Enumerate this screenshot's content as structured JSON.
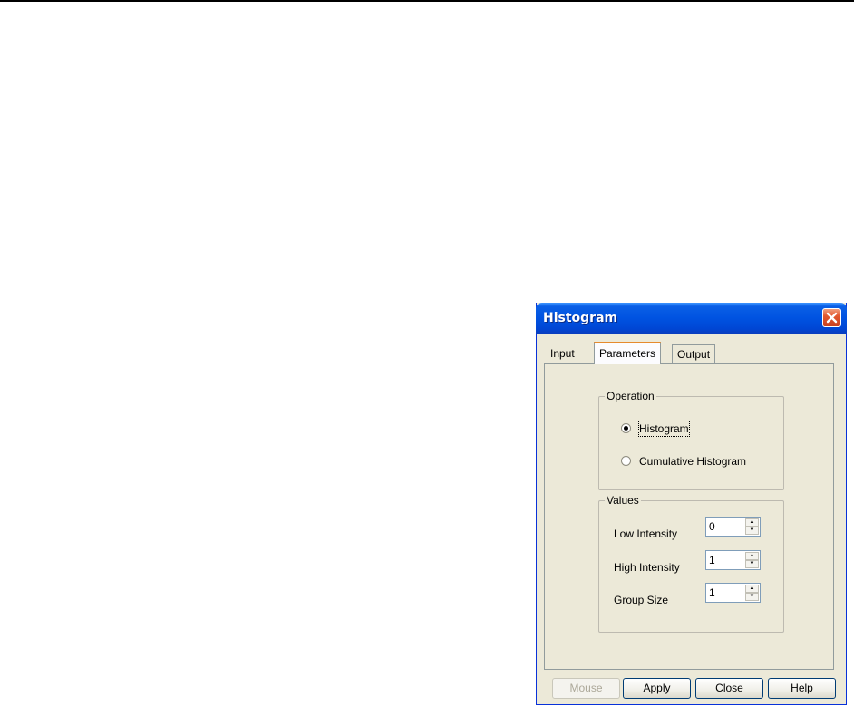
{
  "window": {
    "title": "Histogram"
  },
  "tabs": [
    {
      "label": "Input"
    },
    {
      "label": "Parameters"
    },
    {
      "label": "Output"
    }
  ],
  "operation": {
    "group_label": "Operation",
    "options": [
      {
        "label": "Histogram",
        "checked": true
      },
      {
        "label": "Cumulative Histogram",
        "checked": false
      }
    ]
  },
  "values": {
    "group_label": "Values",
    "fields": [
      {
        "label": "Low Intensity",
        "value": "0"
      },
      {
        "label": "High Intensity",
        "value": "1"
      },
      {
        "label": "Group Size",
        "value": "1"
      }
    ]
  },
  "buttons": {
    "mouse": "Mouse",
    "apply": "Apply",
    "close": "Close",
    "help": "Help"
  },
  "colors": {
    "titlebar": "#0053e1",
    "close_button": "#e2582f",
    "dialog_bg": "#ece9d8"
  }
}
